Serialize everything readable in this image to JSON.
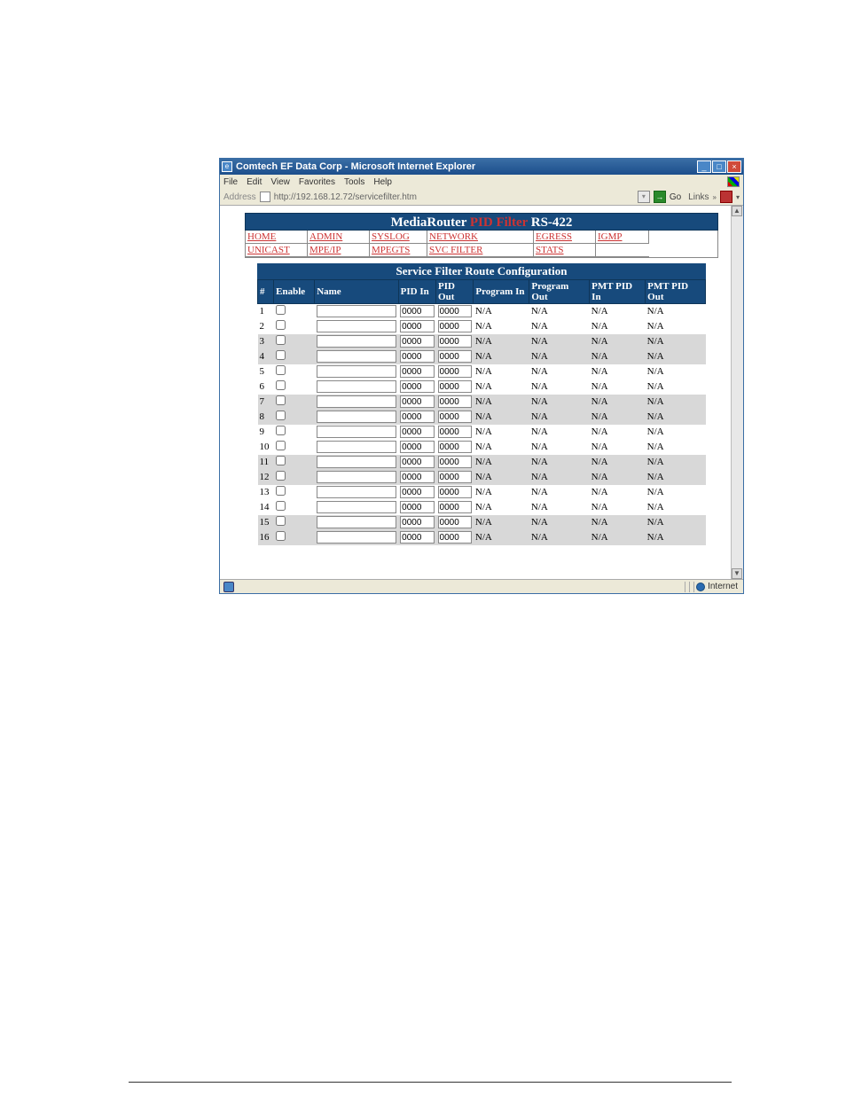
{
  "window": {
    "title": "Comtech EF Data Corp - Microsoft Internet Explorer",
    "menus": [
      "File",
      "Edit",
      "View",
      "Favorites",
      "Tools",
      "Help"
    ],
    "address_label": "Address",
    "address_url": "http://192.168.12.72/servicefilter.htm",
    "go_label": "Go",
    "links_label": "Links",
    "status_zone": "Internet"
  },
  "page": {
    "title_prefix": "MediaRouter ",
    "title_highlight": "PID Filter",
    "title_suffix": " RS-422",
    "nav_rows": [
      [
        "HOME",
        "ADMIN",
        "SYSLOG",
        "NETWORK",
        "EGRESS",
        "IGMP"
      ],
      [
        "UNICAST",
        "MPE/IP",
        "MPEGTS",
        "SVC FILTER",
        "STATS",
        ""
      ]
    ],
    "config_title": "Service Filter Route Configuration",
    "columns": [
      "#",
      "Enable",
      "Name",
      "PID In",
      "PID Out",
      "Program In",
      "Program Out",
      "PMT PID In",
      "PMT PID Out"
    ],
    "rows": [
      {
        "n": "1",
        "shaded": false,
        "enable": false,
        "name": "",
        "pidIn": "0000",
        "pidOut": "0000",
        "progIn": "N/A",
        "progOut": "N/A",
        "pmtIn": "N/A",
        "pmtOut": "N/A"
      },
      {
        "n": "2",
        "shaded": false,
        "enable": false,
        "name": "",
        "pidIn": "0000",
        "pidOut": "0000",
        "progIn": "N/A",
        "progOut": "N/A",
        "pmtIn": "N/A",
        "pmtOut": "N/A"
      },
      {
        "n": "3",
        "shaded": true,
        "enable": false,
        "name": "",
        "pidIn": "0000",
        "pidOut": "0000",
        "progIn": "N/A",
        "progOut": "N/A",
        "pmtIn": "N/A",
        "pmtOut": "N/A"
      },
      {
        "n": "4",
        "shaded": true,
        "enable": false,
        "name": "",
        "pidIn": "0000",
        "pidOut": "0000",
        "progIn": "N/A",
        "progOut": "N/A",
        "pmtIn": "N/A",
        "pmtOut": "N/A"
      },
      {
        "n": "5",
        "shaded": false,
        "enable": false,
        "name": "",
        "pidIn": "0000",
        "pidOut": "0000",
        "progIn": "N/A",
        "progOut": "N/A",
        "pmtIn": "N/A",
        "pmtOut": "N/A"
      },
      {
        "n": "6",
        "shaded": false,
        "enable": false,
        "name": "",
        "pidIn": "0000",
        "pidOut": "0000",
        "progIn": "N/A",
        "progOut": "N/A",
        "pmtIn": "N/A",
        "pmtOut": "N/A"
      },
      {
        "n": "7",
        "shaded": true,
        "enable": false,
        "name": "",
        "pidIn": "0000",
        "pidOut": "0000",
        "progIn": "N/A",
        "progOut": "N/A",
        "pmtIn": "N/A",
        "pmtOut": "N/A"
      },
      {
        "n": "8",
        "shaded": true,
        "enable": false,
        "name": "",
        "pidIn": "0000",
        "pidOut": "0000",
        "progIn": "N/A",
        "progOut": "N/A",
        "pmtIn": "N/A",
        "pmtOut": "N/A"
      },
      {
        "n": "9",
        "shaded": false,
        "enable": false,
        "name": "",
        "pidIn": "0000",
        "pidOut": "0000",
        "progIn": "N/A",
        "progOut": "N/A",
        "pmtIn": "N/A",
        "pmtOut": "N/A"
      },
      {
        "n": "10",
        "shaded": false,
        "enable": false,
        "name": "",
        "pidIn": "0000",
        "pidOut": "0000",
        "progIn": "N/A",
        "progOut": "N/A",
        "pmtIn": "N/A",
        "pmtOut": "N/A"
      },
      {
        "n": "11",
        "shaded": true,
        "enable": false,
        "name": "",
        "pidIn": "0000",
        "pidOut": "0000",
        "progIn": "N/A",
        "progOut": "N/A",
        "pmtIn": "N/A",
        "pmtOut": "N/A"
      },
      {
        "n": "12",
        "shaded": true,
        "enable": false,
        "name": "",
        "pidIn": "0000",
        "pidOut": "0000",
        "progIn": "N/A",
        "progOut": "N/A",
        "pmtIn": "N/A",
        "pmtOut": "N/A"
      },
      {
        "n": "13",
        "shaded": false,
        "enable": false,
        "name": "",
        "pidIn": "0000",
        "pidOut": "0000",
        "progIn": "N/A",
        "progOut": "N/A",
        "pmtIn": "N/A",
        "pmtOut": "N/A"
      },
      {
        "n": "14",
        "shaded": false,
        "enable": false,
        "name": "",
        "pidIn": "0000",
        "pidOut": "0000",
        "progIn": "N/A",
        "progOut": "N/A",
        "pmtIn": "N/A",
        "pmtOut": "N/A"
      },
      {
        "n": "15",
        "shaded": true,
        "enable": false,
        "name": "",
        "pidIn": "0000",
        "pidOut": "0000",
        "progIn": "N/A",
        "progOut": "N/A",
        "pmtIn": "N/A",
        "pmtOut": "N/A"
      },
      {
        "n": "16",
        "shaded": true,
        "enable": false,
        "name": "",
        "pidIn": "0000",
        "pidOut": "0000",
        "progIn": "N/A",
        "progOut": "N/A",
        "pmtIn": "N/A",
        "pmtOut": "N/A"
      }
    ]
  }
}
